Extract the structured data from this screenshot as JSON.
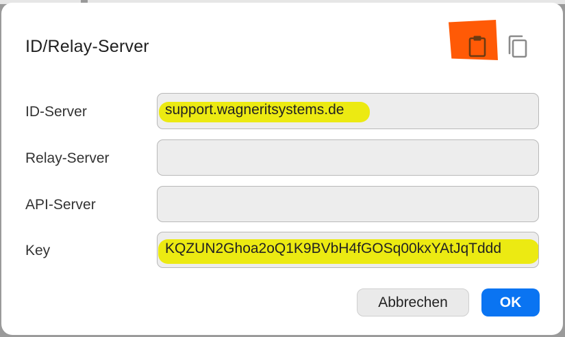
{
  "dialog": {
    "title": "ID/Relay-Server"
  },
  "toolbar": {
    "paste_icon": "clipboard-paste-icon",
    "copy_icon": "copy-icon",
    "paste_highlight_color": "#ff5a06"
  },
  "fields": [
    {
      "label": "ID-Server",
      "value": "support.wagneritsystems.de",
      "highlighted": true
    },
    {
      "label": "Relay-Server",
      "value": "",
      "highlighted": false
    },
    {
      "label": "API-Server",
      "value": "",
      "highlighted": false
    },
    {
      "label": "Key",
      "value": "KQZUN2Ghoa2oQ1K9BVbH4fGOSq00kxYAtJqTddd",
      "highlighted": true
    }
  ],
  "buttons": {
    "cancel_label": "Abbrechen",
    "ok_label": "OK"
  },
  "colors": {
    "accent": "#0a74f2",
    "highlight": "#ecea12"
  }
}
